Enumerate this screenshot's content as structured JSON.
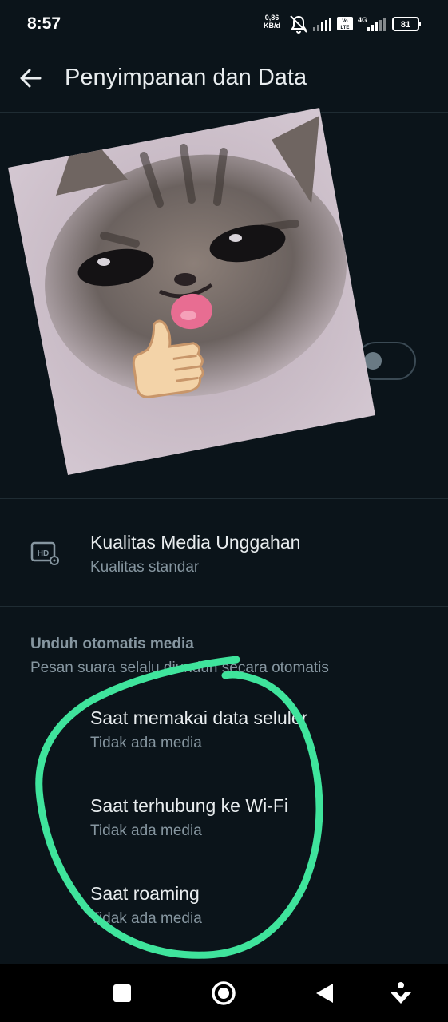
{
  "status_bar": {
    "time": "8:57",
    "net_speed_value": "0,86",
    "net_speed_unit": "KB/d",
    "volte_label": "Vo LTE",
    "network_type": "4G",
    "battery": "81"
  },
  "header": {
    "title": "Penyimpanan dan Data"
  },
  "settings": {
    "media_quality": {
      "title": "Kualitas Media Unggahan",
      "subtitle": "Kualitas standar"
    },
    "auto_download": {
      "heading": "Unduh otomatis media",
      "note": "Pesan suara selalu diunduh secara otomatis",
      "items": [
        {
          "title": "Saat memakai data seluler",
          "subtitle": "Tidak ada media"
        },
        {
          "title": "Saat terhubung ke Wi-Fi",
          "subtitle": "Tidak ada media"
        },
        {
          "title": "Saat roaming",
          "subtitle": "Tidak ada media"
        }
      ]
    }
  },
  "icons": [
    "back-arrow-icon",
    "hd-settings-icon",
    "mute-bell-icon",
    "signal-icon",
    "battery-icon",
    "square-icon",
    "home-circle-icon",
    "back-triangle-icon",
    "accessibility-icon"
  ],
  "colors": {
    "background": "#0b141a",
    "primary_text": "#e9edef",
    "secondary_text": "#8696a0",
    "annotation_stroke": "#3fe49c"
  }
}
